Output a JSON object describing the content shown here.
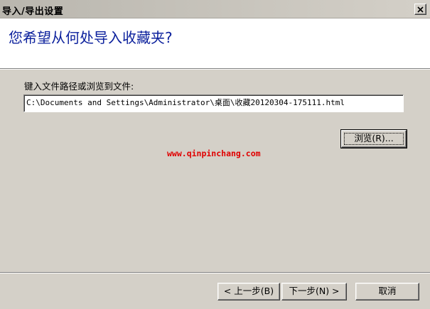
{
  "window": {
    "title": "导入/导出设置",
    "close_icon": "close-icon"
  },
  "header": {
    "question": "您希望从何处导入收藏夹?"
  },
  "form": {
    "path_label": "键入文件路径或浏览到文件:",
    "path_value": "C:\\Documents and Settings\\Administrator\\桌面\\收藏20120304-175111.html",
    "browse_label": "浏览(R)..."
  },
  "watermark": "www.qinpinchang.com",
  "footer": {
    "back_label": "< 上一步(B)",
    "next_label": "下一步(N) >",
    "cancel_label": "取消"
  }
}
